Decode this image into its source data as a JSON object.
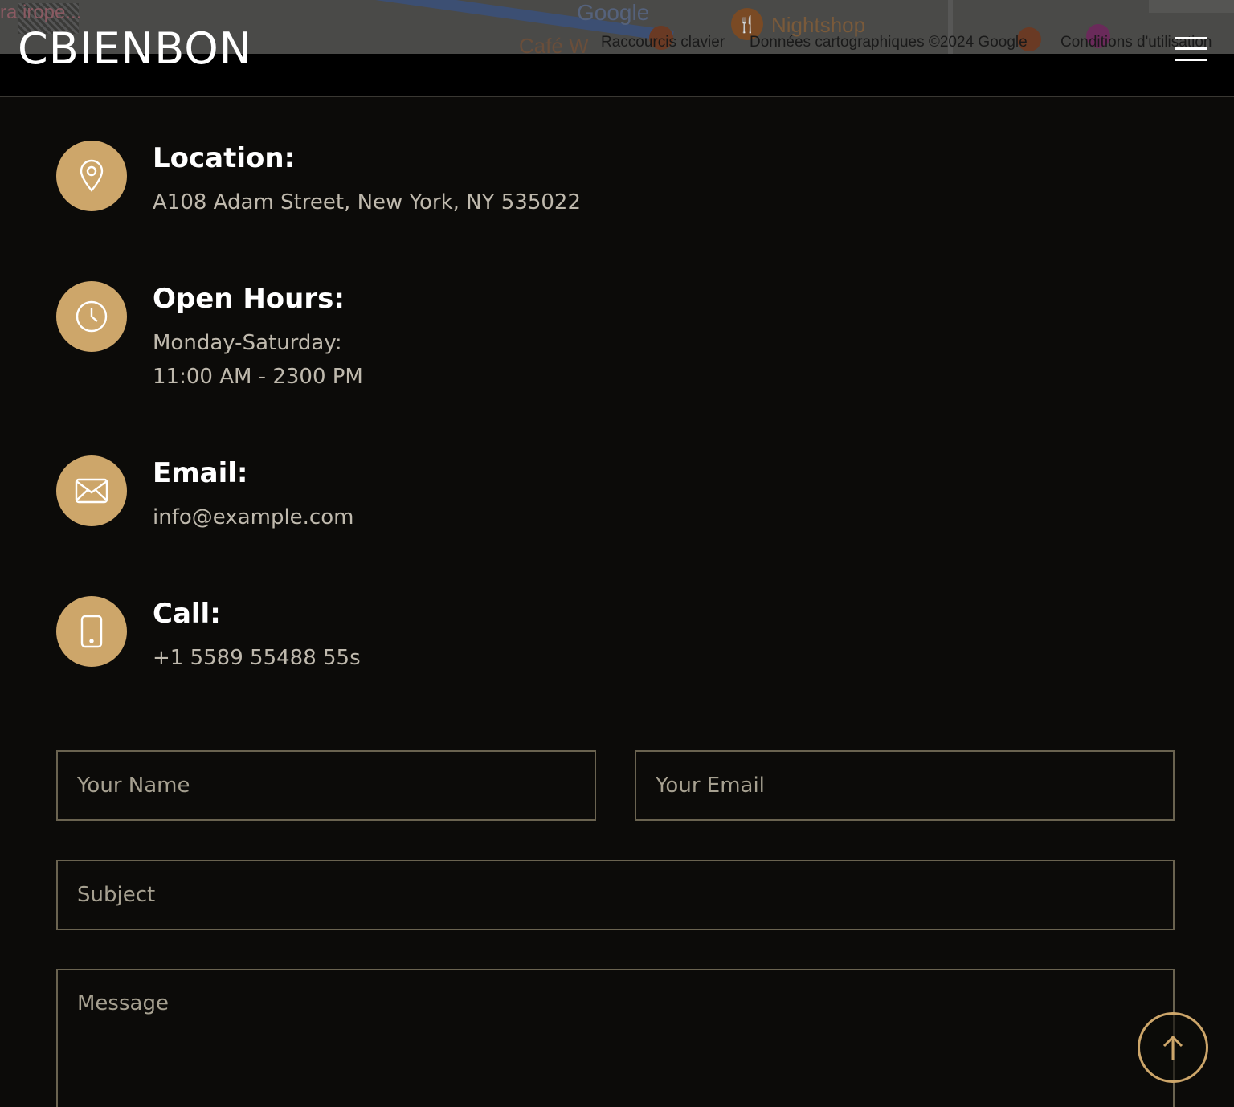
{
  "map": {
    "labels": {
      "region": "ra irope...",
      "google": "Google",
      "place": "Nightshop",
      "cafe": "Café W"
    },
    "attribution": {
      "shortcuts": "Raccourcis clavier",
      "map_data": "Données cartographiques ©2024 Google",
      "terms": "Conditions d'utilisation"
    }
  },
  "header": {
    "logo": "CBIENBON",
    "menu_icon": "hamburger-menu-icon"
  },
  "contact_info": {
    "location": {
      "icon": "map-pin-icon",
      "title": "Location:",
      "lines": [
        "A108 Adam Street, New York, NY 535022"
      ]
    },
    "hours": {
      "icon": "clock-icon",
      "title": "Open Hours:",
      "lines": [
        "Monday-Saturday:",
        "11:00 AM - 2300 PM"
      ]
    },
    "email": {
      "icon": "envelope-icon",
      "title": "Email:",
      "lines": [
        "info@example.com"
      ]
    },
    "call": {
      "icon": "smartphone-icon",
      "title": "Call:",
      "lines": [
        "+1 5589 55488 55s"
      ]
    }
  },
  "form": {
    "name_placeholder": "Your Name",
    "email_placeholder": "Your Email",
    "subject_placeholder": "Subject",
    "message_placeholder": "Message"
  },
  "back_to_top": {
    "icon": "arrow-up-icon"
  },
  "colors": {
    "accent": "#cda66a",
    "background": "#0c0b09",
    "header": "#000000",
    "text_muted": "#bfb9ad",
    "border": "#6a6350"
  }
}
